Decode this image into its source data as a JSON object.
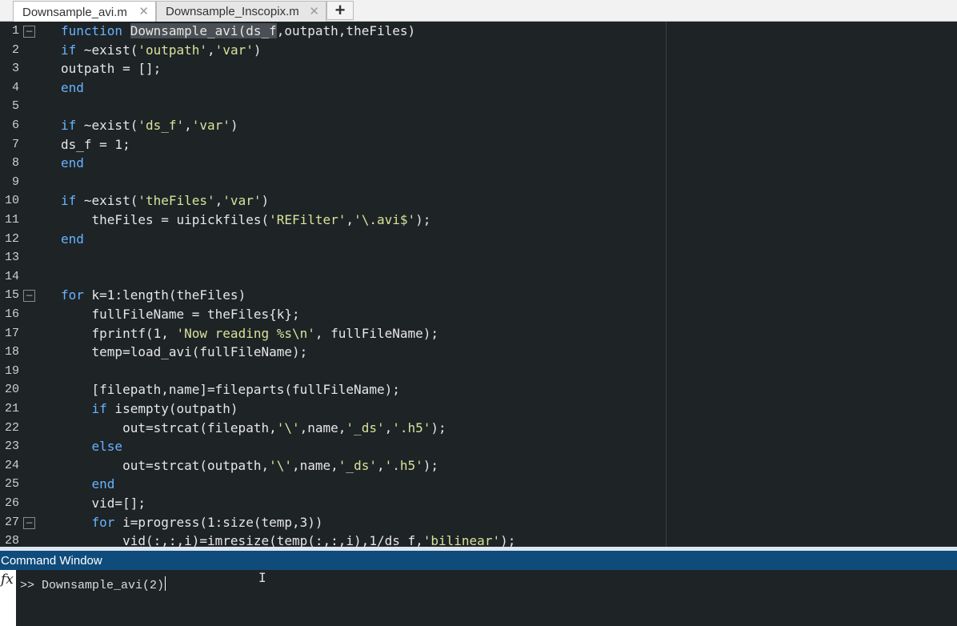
{
  "tabs": [
    {
      "label": "Downsample_avi.m",
      "active": true
    },
    {
      "label": "Downsample_Inscopix.m",
      "active": false
    }
  ],
  "add_tab_symbol": "+",
  "close_symbol": "✕",
  "fold_symbol": "−",
  "fold_lines": [
    1,
    15,
    27
  ],
  "code_lines": [
    [
      {
        "t": "function",
        "c": "kw"
      },
      {
        "t": " "
      },
      {
        "t": "Downsample_avi(ds_f",
        "c": "hl"
      },
      {
        "t": ",outpath,theFiles)"
      }
    ],
    [
      {
        "t": "if",
        "c": "kw"
      },
      {
        "t": " ~exist("
      },
      {
        "t": "'outpath'",
        "c": "str"
      },
      {
        "t": ","
      },
      {
        "t": "'var'",
        "c": "str"
      },
      {
        "t": ")"
      }
    ],
    [
      {
        "t": "outpath = [];"
      }
    ],
    [
      {
        "t": "end",
        "c": "kw"
      }
    ],
    [],
    [
      {
        "t": "if",
        "c": "kw"
      },
      {
        "t": " ~exist("
      },
      {
        "t": "'ds_f'",
        "c": "str"
      },
      {
        "t": ","
      },
      {
        "t": "'var'",
        "c": "str"
      },
      {
        "t": ")"
      }
    ],
    [
      {
        "t": "ds_f = 1;"
      }
    ],
    [
      {
        "t": "end",
        "c": "kw"
      }
    ],
    [],
    [
      {
        "t": "if",
        "c": "kw"
      },
      {
        "t": " ~exist("
      },
      {
        "t": "'theFiles'",
        "c": "str"
      },
      {
        "t": ","
      },
      {
        "t": "'var'",
        "c": "str"
      },
      {
        "t": ")"
      }
    ],
    [
      {
        "t": "    theFiles = uipickfiles("
      },
      {
        "t": "'REFilter'",
        "c": "str"
      },
      {
        "t": ","
      },
      {
        "t": "'\\.avi$'",
        "c": "str"
      },
      {
        "t": ");"
      }
    ],
    [
      {
        "t": "end",
        "c": "kw"
      }
    ],
    [],
    [],
    [
      {
        "t": "for",
        "c": "kw"
      },
      {
        "t": " k=1:length(theFiles)"
      }
    ],
    [
      {
        "t": "    fullFileName = theFiles{k};"
      }
    ],
    [
      {
        "t": "    fprintf(1, "
      },
      {
        "t": "'Now reading %s\\n'",
        "c": "str"
      },
      {
        "t": ", fullFileName);"
      }
    ],
    [
      {
        "t": "    temp=load_avi(fullFileName);"
      }
    ],
    [],
    [
      {
        "t": "    [filepath,name]=fileparts(fullFileName);"
      }
    ],
    [
      {
        "t": "    "
      },
      {
        "t": "if",
        "c": "kw"
      },
      {
        "t": " isempty(outpath)"
      }
    ],
    [
      {
        "t": "        out=strcat(filepath,"
      },
      {
        "t": "'\\'",
        "c": "str"
      },
      {
        "t": ",name,"
      },
      {
        "t": "'_ds'",
        "c": "str"
      },
      {
        "t": ","
      },
      {
        "t": "'.h5'",
        "c": "str"
      },
      {
        "t": ");"
      }
    ],
    [
      {
        "t": "    "
      },
      {
        "t": "else",
        "c": "kw"
      }
    ],
    [
      {
        "t": "        out=strcat(outpath,"
      },
      {
        "t": "'\\'",
        "c": "str"
      },
      {
        "t": ",name,"
      },
      {
        "t": "'_ds'",
        "c": "str"
      },
      {
        "t": ","
      },
      {
        "t": "'.h5'",
        "c": "str"
      },
      {
        "t": ");"
      }
    ],
    [
      {
        "t": "    "
      },
      {
        "t": "end",
        "c": "kw"
      }
    ],
    [
      {
        "t": "    vid=[];"
      }
    ],
    [
      {
        "t": "    "
      },
      {
        "t": "for",
        "c": "kw"
      },
      {
        "t": " i=progress(1:size(temp,3))"
      }
    ],
    [
      {
        "t": "        vid(:,:,i)=imresize(temp(:,:,i),1/ds_f,"
      },
      {
        "t": "'bilinear'",
        "c": "str"
      },
      {
        "t": ");"
      }
    ]
  ],
  "command_window": {
    "title": "Command Window",
    "fx_label": "fx",
    "prompt": ">> ",
    "command": "Downsample_avi(2)"
  },
  "colors": {
    "editor_bg": "#1e2326",
    "keyword": "#68b3ff",
    "string": "#d8e29a",
    "highlight": "#4a4f55",
    "cmd_title_bg": "#0f4c7c"
  },
  "mouse_cursor_icon": "ibeam-cursor-icon"
}
